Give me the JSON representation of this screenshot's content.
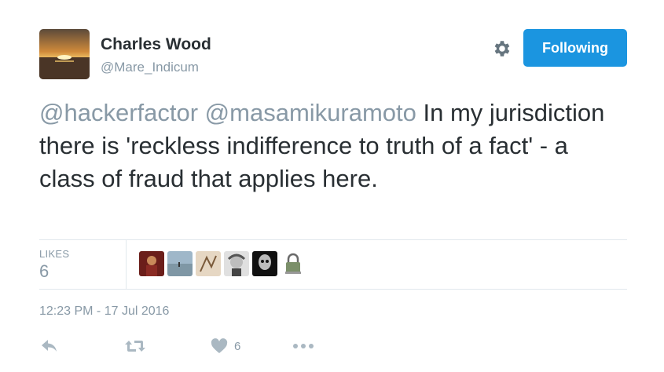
{
  "author": {
    "name": "Charles Wood",
    "handle": "@Mare_Indicum",
    "avatar_icon": "sunset-avatar"
  },
  "follow_button": {
    "label": "Following",
    "color": "#1b95e0"
  },
  "settings_icon": "gear-icon",
  "tweet": {
    "mention1": "@hackerfactor",
    "mention2": "@masamikuramoto",
    "body": "In my jurisdiction there is 'reckless indifference to truth of a fact' - a class of fraud that applies here."
  },
  "likes": {
    "label": "LIKES",
    "count": "6",
    "liker_avatars": [
      "warrior-avatar",
      "beach-avatar",
      "sketch-avatar",
      "beethoven-avatar",
      "skull-avatar",
      "lock-avatar"
    ]
  },
  "timestamp": "12:23 PM - 17 Jul 2016",
  "actions": {
    "reply_icon": "reply-icon",
    "retweet_icon": "retweet-icon",
    "like_icon": "heart-icon",
    "like_count": "6",
    "more_icon": "more-icon"
  },
  "colors": {
    "text": "#292f33",
    "muted": "#8899a6",
    "accent": "#1b95e0",
    "border": "#e1e8ed"
  }
}
